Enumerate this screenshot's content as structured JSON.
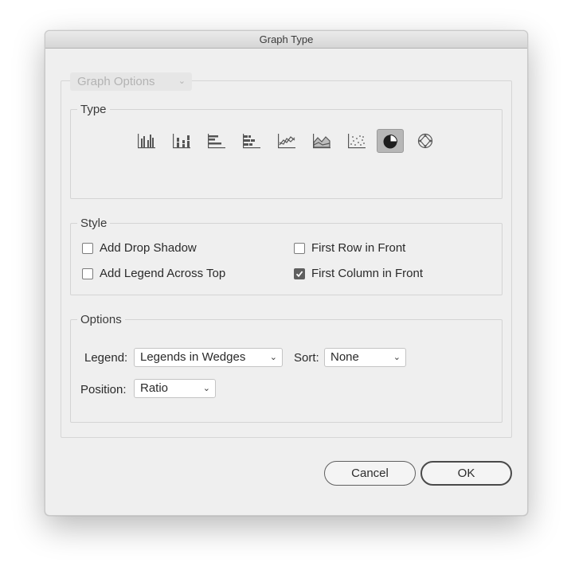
{
  "window": {
    "title": "Graph Type"
  },
  "graph_options": {
    "label": "Graph Options"
  },
  "type_group": {
    "label": "Type",
    "types": [
      {
        "icon": "grouped-column-graph-icon"
      },
      {
        "icon": "stacked-column-graph-icon"
      },
      {
        "icon": "grouped-bar-graph-icon"
      },
      {
        "icon": "stacked-bar-graph-icon"
      },
      {
        "icon": "line-graph-icon"
      },
      {
        "icon": "area-graph-icon"
      },
      {
        "icon": "scatter-graph-icon"
      },
      {
        "icon": "pie-graph-icon",
        "selected": true
      },
      {
        "icon": "radar-graph-icon"
      }
    ]
  },
  "style_group": {
    "label": "Style",
    "add_drop_shadow": {
      "label": "Add Drop Shadow",
      "checked": false
    },
    "add_legend_across_top": {
      "label": "Add Legend Across Top",
      "checked": false
    },
    "first_row_in_front": {
      "label": "First Row in Front",
      "checked": false
    },
    "first_column_in_front": {
      "label": "First Column in Front",
      "checked": true
    }
  },
  "options_group": {
    "label": "Options",
    "legend": {
      "label": "Legend:",
      "value": "Legends in Wedges"
    },
    "sort": {
      "label": "Sort:",
      "value": "None"
    },
    "position": {
      "label": "Position:",
      "value": "Ratio"
    }
  },
  "buttons": {
    "cancel": "Cancel",
    "ok": "OK"
  },
  "colors": {
    "selected_bg": "#b7b7b7",
    "dialog_bg": "#efefef",
    "check_fill": "#5e5e5e"
  }
}
